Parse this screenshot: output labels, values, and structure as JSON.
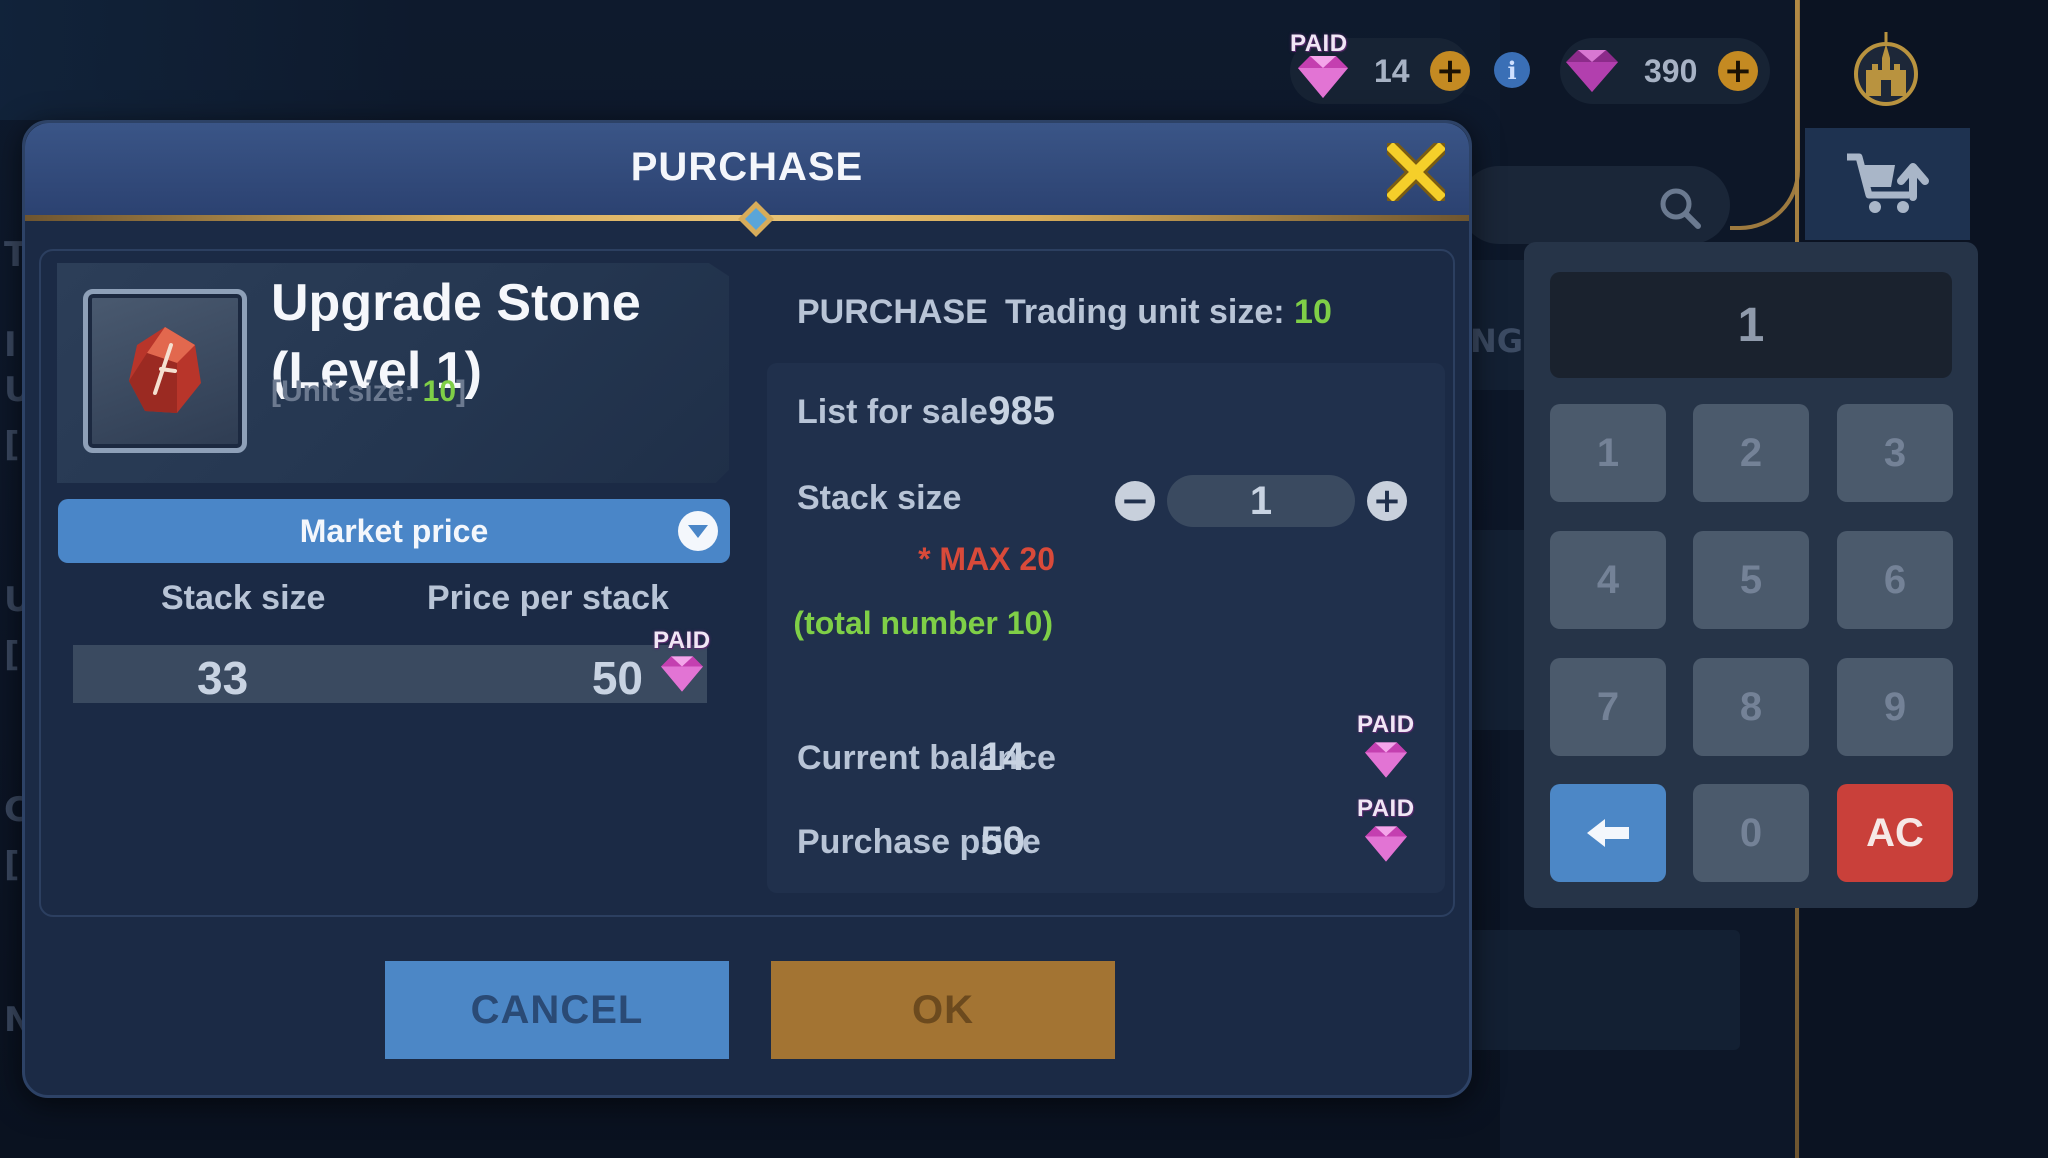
{
  "currency": {
    "paid_label": "PAID",
    "paid_amount": "14",
    "gem_amount": "390",
    "plus_symbol": "+",
    "info_symbol": "i"
  },
  "background": {
    "ng_text": "NG",
    "side_letters": [
      "T",
      "I",
      "U",
      "[",
      "U",
      "[",
      "C",
      "[",
      "N"
    ]
  },
  "modal": {
    "title": "PURCHASE",
    "close_icon": "close-x-icon",
    "item": {
      "name": "Upgrade Stone (Level 1)",
      "unit_size_prefix": "[Unit size: ",
      "unit_size_value": "10",
      "unit_size_suffix": "]",
      "icon": "upgrade-stone-icon"
    },
    "price_mode": {
      "selected": "Market price"
    },
    "listing_table": {
      "headers": [
        "Stack size",
        "Price per stack"
      ],
      "rows": [
        {
          "stack_size": "33",
          "price_per_stack": "50",
          "currency_tag": "PAID"
        }
      ]
    },
    "details": {
      "section_label": "PURCHASE",
      "trading_unit_label": "Trading unit size: ",
      "trading_unit_value": "10",
      "list_for_sale_label": "List for sale",
      "list_for_sale_value": "985",
      "stack_size_label": "Stack size",
      "stack_size_value": "1",
      "minus_symbol": "−",
      "plus_symbol": "+",
      "max_note": "* MAX 20",
      "total_note": "(total number 10)",
      "current_balance_label": "Current balance",
      "current_balance_value": "14",
      "purchase_price_label": "Purchase price",
      "purchase_price_value": "50",
      "currency_tag": "PAID"
    },
    "buttons": {
      "cancel": "CANCEL",
      "ok": "OK"
    }
  },
  "numpad": {
    "display": "1",
    "keys": [
      "1",
      "2",
      "3",
      "4",
      "5",
      "6",
      "7",
      "8",
      "9"
    ],
    "zero": "0",
    "clear": "AC",
    "backspace_icon": "backspace-arrow-icon"
  },
  "colors": {
    "accent_green": "#7fcf47",
    "warning_red": "#d94a3a",
    "primary_blue": "#4c87c6",
    "gold": "#d7ac5a",
    "gem_pink": "#d24fc0"
  }
}
